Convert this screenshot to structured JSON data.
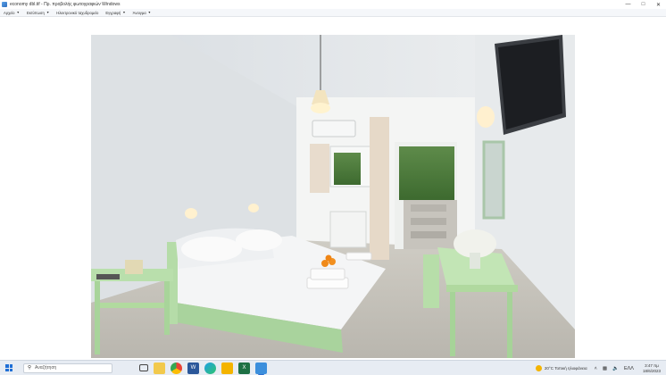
{
  "window": {
    "title": "economy dbl.tif - Πρ. προβολής φωτογραφιών Windows",
    "controls": [
      "minimize-icon",
      "maximize-icon",
      "close-icon"
    ]
  },
  "menu": [
    {
      "label": "Αρχείο"
    },
    {
      "label": "Εκτύπωση"
    },
    {
      "label": "Ηλεκτρονικό ταχυδρομείο"
    },
    {
      "label": "Εγγραφή"
    },
    {
      "label": "Άνοιγμα"
    }
  ],
  "viewer_toolbar": {
    "buttons": [
      "zoom-icon",
      "fit-icon",
      "previous-icon",
      "slideshow-icon",
      "next-icon",
      "rotate-left-icon",
      "rotate-right-icon",
      "delete-icon"
    ]
  },
  "taskbar": {
    "search_placeholder": "Αναζήτηση",
    "weather": "20°C  Τοπική ηλιοφάνεια",
    "language": "ΕΛΛ",
    "time": "3:47 πμ",
    "date": "18/6/2023",
    "colors": {
      "accent": "#2f6fd0",
      "taskbar": "#e7ecf3"
    }
  }
}
